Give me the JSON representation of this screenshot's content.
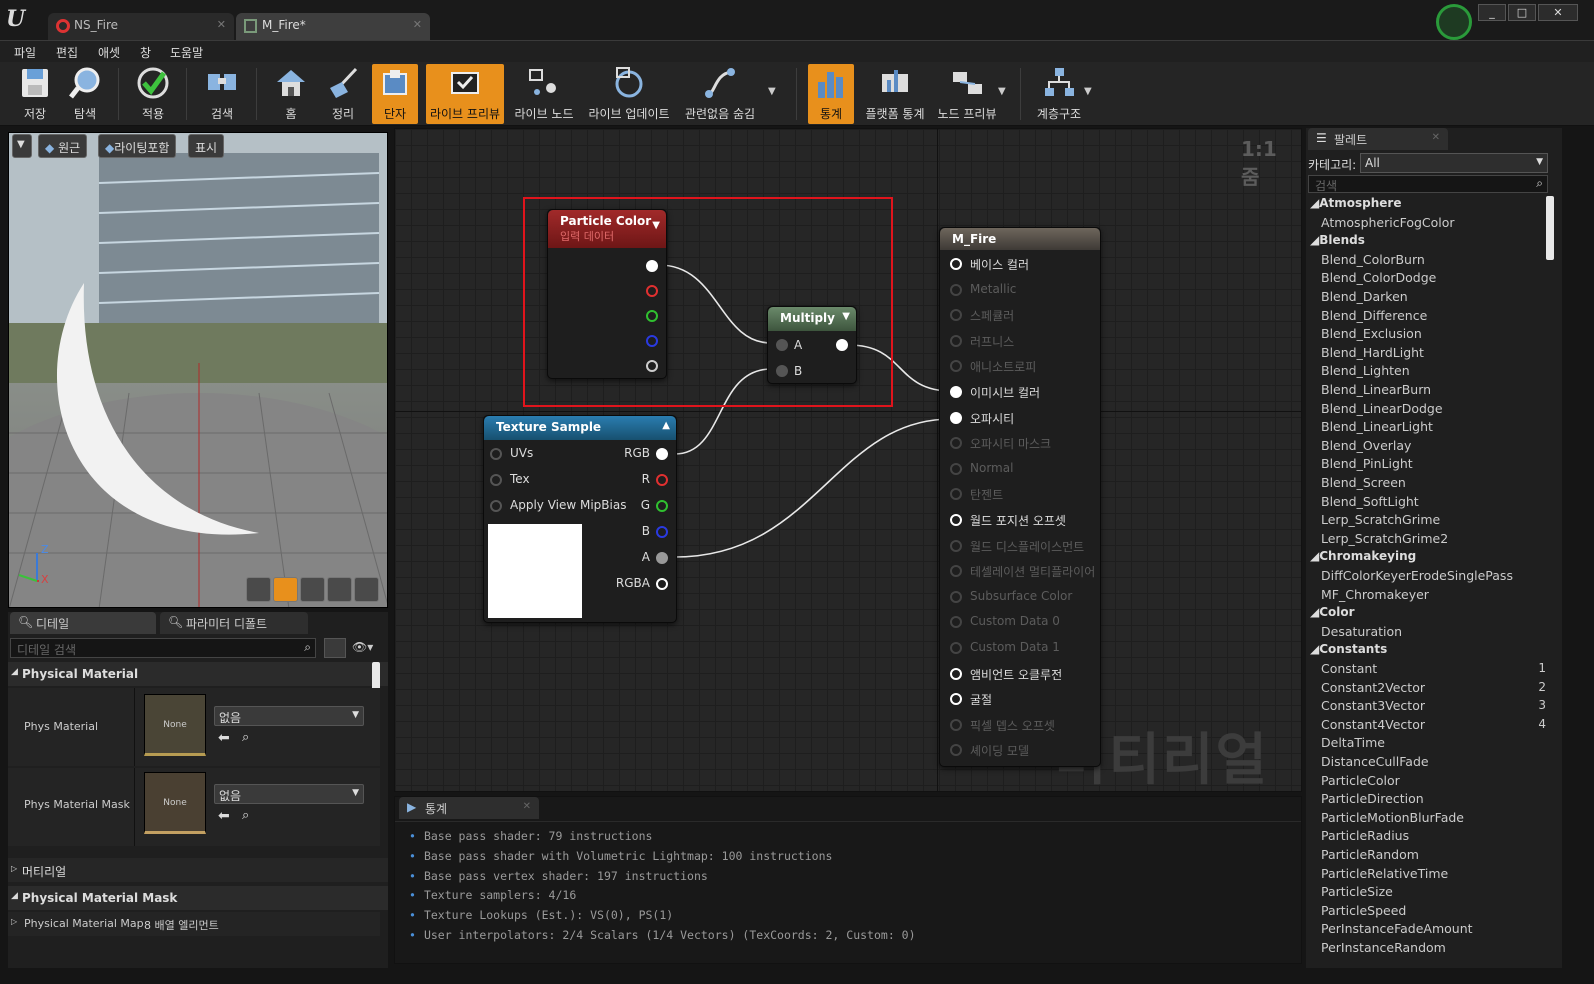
{
  "titlebar": {
    "tabs": [
      {
        "label": "NS_Fire"
      },
      {
        "label": "M_Fire*"
      }
    ],
    "window_buttons": [
      "_",
      "□",
      "✕"
    ]
  },
  "menu": [
    "파일",
    "편집",
    "애셋",
    "창",
    "도움말"
  ],
  "toolbar": [
    {
      "label": "저장",
      "icon": "save-icon"
    },
    {
      "label": "탐색",
      "icon": "browse-icon"
    },
    {
      "label": "적용",
      "icon": "apply-icon"
    },
    {
      "label": "검색",
      "icon": "search-icon"
    },
    {
      "label": "홈",
      "icon": "home-icon"
    },
    {
      "label": "정리",
      "icon": "clean-icon"
    },
    {
      "label": "단자",
      "icon": "connectors-icon",
      "active": true
    },
    {
      "label": "라이브 프리뷰",
      "icon": "live-preview-icon",
      "active": true
    },
    {
      "label": "라이브 노드",
      "icon": "live-nodes-icon"
    },
    {
      "label": "라이브 업데이트",
      "icon": "live-update-icon"
    },
    {
      "label": "관련없음 숨김",
      "icon": "hide-unrelated-icon"
    },
    {
      "label": "통계",
      "icon": "stats-icon",
      "active": true
    },
    {
      "label": "플랫폼 통계",
      "icon": "platform-stats-icon"
    },
    {
      "label": "노드 프리뷰",
      "icon": "node-preview-icon"
    },
    {
      "label": "계층구조",
      "icon": "hierarchy-icon"
    }
  ],
  "viewport": {
    "buttons": [
      "원근",
      "라이팅포함",
      "표시"
    ],
    "axes": {
      "z": "Z",
      "x": "X"
    }
  },
  "details": {
    "tabs": [
      "디테일",
      "파라미터 디폴트"
    ],
    "search_placeholder": "디테일 검색",
    "sections": {
      "physical_material": "Physical Material",
      "material": "머티리얼",
      "physical_material_mask": "Physical Material Mask"
    },
    "rows": [
      {
        "label": "Phys Material",
        "thumb": "None",
        "value": "없음"
      },
      {
        "label": "Phys Material Mask",
        "thumb": "None",
        "value": "없음"
      }
    ],
    "map_row": {
      "label": "Physical Material Map",
      "value": "8 배열 엘리먼트"
    }
  },
  "graph": {
    "zoom": "1:1 줌",
    "watermark": "머티리얼",
    "particle_color": {
      "title": "Particle Color",
      "subtitle": "입력 데이터"
    },
    "multiply": {
      "title": "Multiply",
      "pins": [
        "A",
        "B"
      ]
    },
    "texture_sample": {
      "title": "Texture Sample",
      "inputs": [
        "UVs",
        "Tex",
        "Apply View MipBias"
      ],
      "outputs": [
        "RGB",
        "R",
        "G",
        "B",
        "A",
        "RGBA"
      ]
    },
    "result": {
      "title": "M_Fire",
      "pins": [
        {
          "label": "베이스 컬러",
          "active": true
        },
        {
          "label": "Metallic",
          "active": false
        },
        {
          "label": "스페큘러",
          "active": false
        },
        {
          "label": "러프니스",
          "active": false
        },
        {
          "label": "애니소트로피",
          "active": false
        },
        {
          "label": "이미시브 컬러",
          "active": true
        },
        {
          "label": "오파시티",
          "active": true
        },
        {
          "label": "오파시티 마스크",
          "active": false
        },
        {
          "label": "Normal",
          "active": false
        },
        {
          "label": "탄젠트",
          "active": false
        },
        {
          "label": "월드 포지션 오프셋",
          "active": true
        },
        {
          "label": "월드 디스플레이스먼트",
          "active": false
        },
        {
          "label": "테셀레이션 멀티플라이어",
          "active": false
        },
        {
          "label": "Subsurface Color",
          "active": false
        },
        {
          "label": "Custom Data 0",
          "active": false
        },
        {
          "label": "Custom Data 1",
          "active": false
        },
        {
          "label": "앰비언트 오클루전",
          "active": true
        },
        {
          "label": "굴절",
          "active": true
        },
        {
          "label": "픽셀 뎁스 오프셋",
          "active": false
        },
        {
          "label": "셰이딩 모델",
          "active": false
        }
      ]
    }
  },
  "stats": {
    "tab": "통계",
    "lines": [
      "Base pass shader: 79 instructions",
      "Base pass shader with Volumetric Lightmap: 100 instructions",
      "Base pass vertex shader: 197 instructions",
      "Texture samplers: 4/16",
      "Texture Lookups (Est.): VS(0), PS(1)",
      "User interpolators: 2/4 Scalars (1/4 Vectors) (TexCoords: 2, Custom: 0)"
    ]
  },
  "palette": {
    "tab": "팔레트",
    "category_label": "카테고리:",
    "category_value": "All",
    "search_placeholder": "검색",
    "rows": [
      {
        "cat": "Atmosphere"
      },
      {
        "item": "AtmosphericFogColor"
      },
      {
        "cat": "Blends"
      },
      {
        "item": "Blend_ColorBurn"
      },
      {
        "item": "Blend_ColorDodge"
      },
      {
        "item": "Blend_Darken"
      },
      {
        "item": "Blend_Difference"
      },
      {
        "item": "Blend_Exclusion"
      },
      {
        "item": "Blend_HardLight"
      },
      {
        "item": "Blend_Lighten"
      },
      {
        "item": "Blend_LinearBurn"
      },
      {
        "item": "Blend_LinearDodge"
      },
      {
        "item": "Blend_LinearLight"
      },
      {
        "item": "Blend_Overlay"
      },
      {
        "item": "Blend_PinLight"
      },
      {
        "item": "Blend_Screen"
      },
      {
        "item": "Blend_SoftLight"
      },
      {
        "item": "Lerp_ScratchGrime"
      },
      {
        "item": "Lerp_ScratchGrime2"
      },
      {
        "cat": "Chromakeying"
      },
      {
        "item": "DiffColorKeyerErodeSinglePass"
      },
      {
        "item": "MF_Chromakeyer"
      },
      {
        "cat": "Color"
      },
      {
        "item": "Desaturation"
      },
      {
        "cat": "Constants"
      },
      {
        "item": "Constant",
        "num": "1"
      },
      {
        "item": "Constant2Vector",
        "num": "2"
      },
      {
        "item": "Constant3Vector",
        "num": "3"
      },
      {
        "item": "Constant4Vector",
        "num": "4"
      },
      {
        "item": "DeltaTime"
      },
      {
        "item": "DistanceCullFade"
      },
      {
        "item": "ParticleColor"
      },
      {
        "item": "ParticleDirection"
      },
      {
        "item": "ParticleMotionBlurFade"
      },
      {
        "item": "ParticleRadius"
      },
      {
        "item": "ParticleRandom"
      },
      {
        "item": "ParticleRelativeTime"
      },
      {
        "item": "ParticleSize"
      },
      {
        "item": "ParticleSpeed"
      },
      {
        "item": "PerInstanceFadeAmount"
      },
      {
        "item": "PerInstanceRandom"
      }
    ]
  },
  "colors": {
    "accent": "#e8901c",
    "highlight_box": "#e0141c",
    "particle_header": "#8a1e1e",
    "multiply_header": "#4f6b4f",
    "texture_header": "#1f6a96",
    "result_header": "#5a524a"
  }
}
